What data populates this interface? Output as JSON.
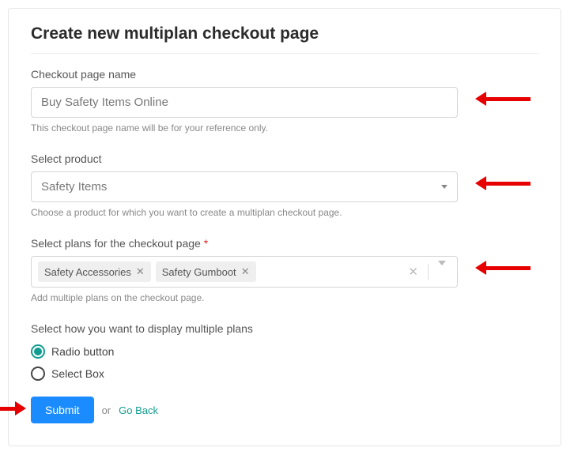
{
  "page_title": "Create new multiplan checkout page",
  "fields": {
    "name": {
      "label": "Checkout page name",
      "value": "Buy Safety Items Online",
      "helper": "This checkout page name will be for your reference only."
    },
    "product": {
      "label": "Select product",
      "value": "Safety Items",
      "helper": "Choose a product for which you want to create a multiplan checkout page."
    },
    "plans": {
      "label": "Select plans for the checkout page ",
      "required_marker": "*",
      "selected": [
        "Safety Accessories",
        "Safety Gumboot"
      ],
      "helper": "Add multiple plans on the checkout page."
    },
    "display": {
      "label": "Select how you want to display multiple plans",
      "options": [
        {
          "label": "Radio button",
          "checked": true
        },
        {
          "label": "Select Box",
          "checked": false
        }
      ]
    }
  },
  "actions": {
    "submit": "Submit",
    "or": "or",
    "go_back": "Go Back"
  }
}
